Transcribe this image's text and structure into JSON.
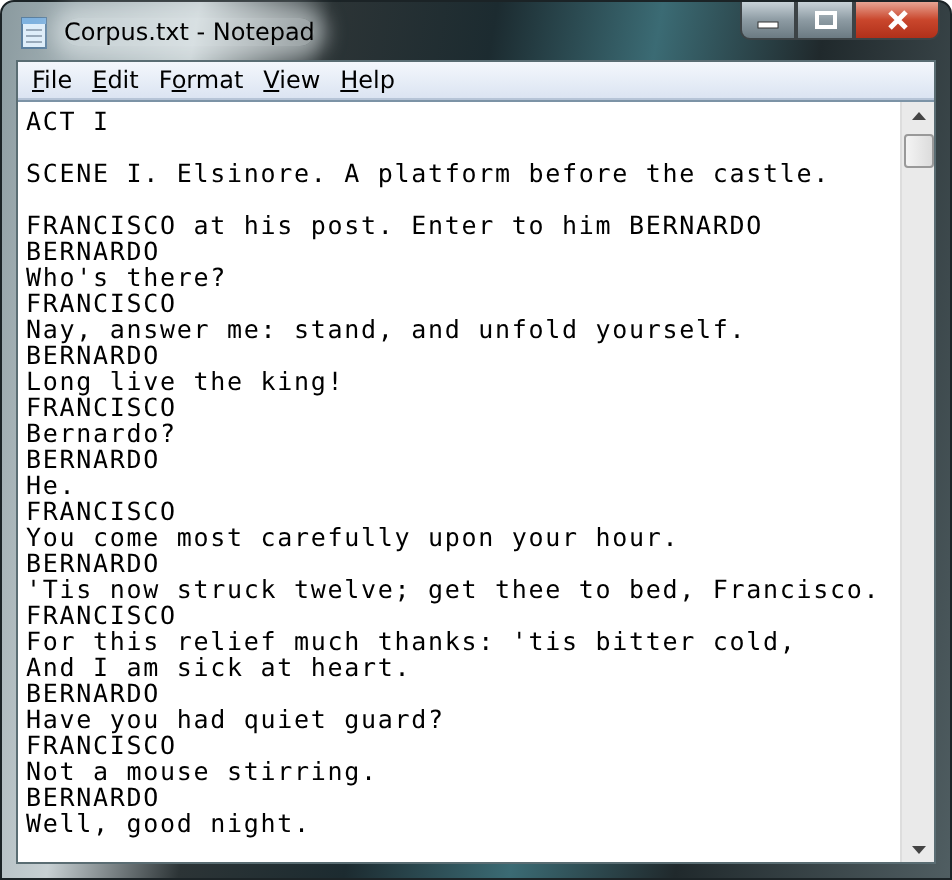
{
  "window": {
    "title": "Corpus.txt - Notepad"
  },
  "menu": [
    {
      "key": "F",
      "rest": "ile"
    },
    {
      "key": "E",
      "rest": "dit"
    },
    {
      "key": "o",
      "rest": "rmat",
      "before": "F"
    },
    {
      "key": "V",
      "rest": "iew"
    },
    {
      "key": "H",
      "rest": "elp"
    }
  ],
  "paragraphs": [
    {
      "lines": [
        "ACT I"
      ]
    },
    {
      "lines": [
        "SCENE I. Elsinore. A platform before the castle."
      ]
    },
    {
      "lines": [
        "FRANCISCO at his post. Enter to him BERNARDO",
        "BERNARDO",
        "Who's there?",
        "FRANCISCO",
        "Nay, answer me: stand, and unfold yourself.",
        "BERNARDO",
        "Long live the king!",
        "FRANCISCO",
        "Bernardo?",
        "BERNARDO",
        "He.",
        "FRANCISCO",
        "You come most carefully upon your hour.",
        "BERNARDO",
        "'Tis now struck twelve; get thee to bed, Francisco.",
        "FRANCISCO",
        "For this relief much thanks: 'tis bitter cold,",
        "And I am sick at heart.",
        "BERNARDO",
        "Have you had quiet guard?",
        "FRANCISCO",
        "Not a mouse stirring.",
        "BERNARDO",
        "Well, good night."
      ]
    }
  ]
}
